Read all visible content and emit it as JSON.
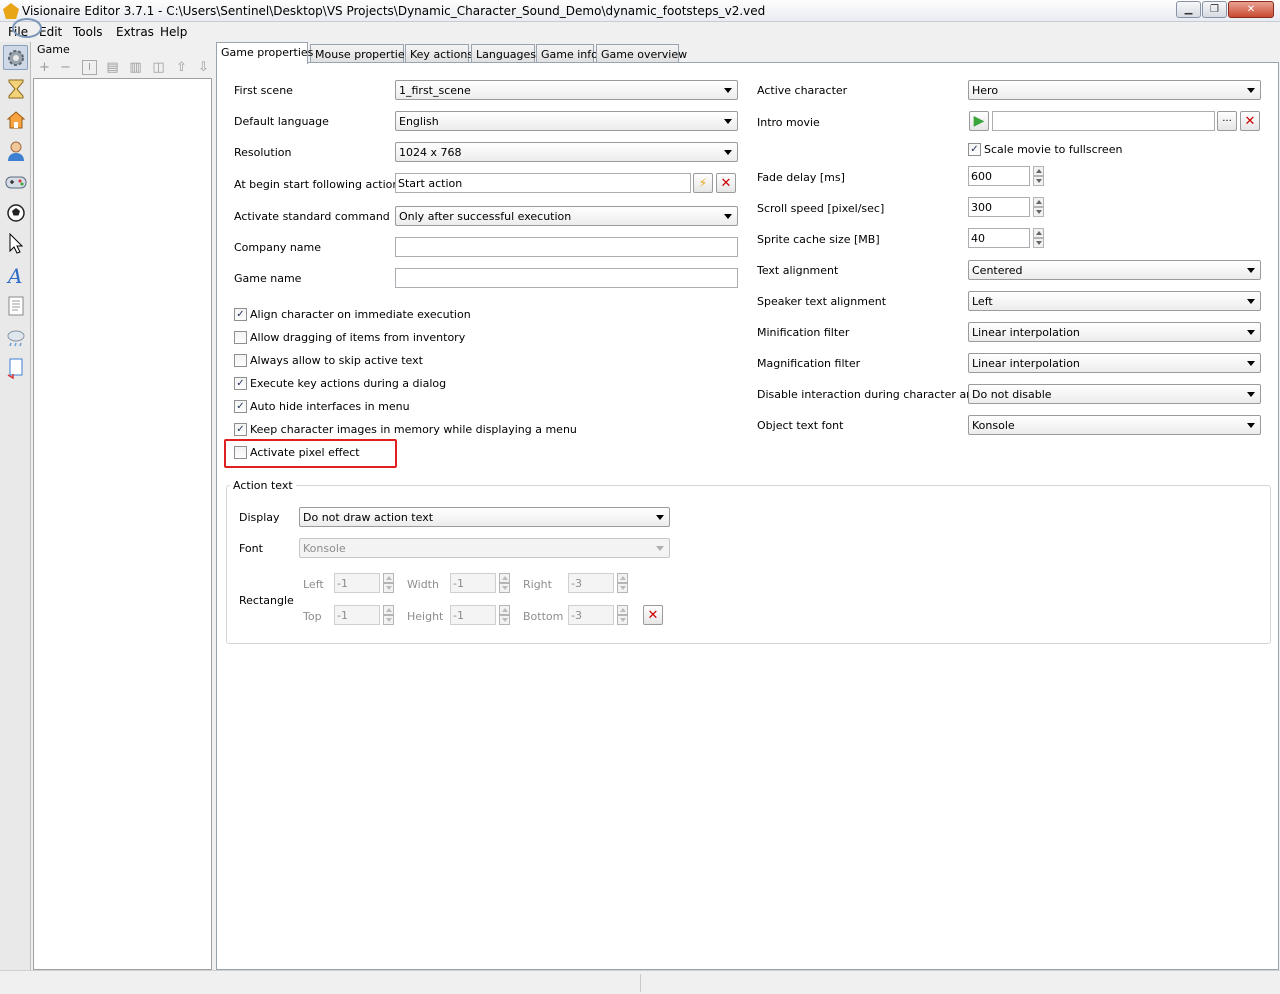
{
  "window": {
    "title": "Visionaire Editor 3.7.1 - C:\\Users\\Sentinel\\Desktop\\VS Projects\\Dynamic_Character_Sound_Demo\\dynamic_footsteps_v2.ved",
    "minimize": "▁",
    "restore": "❐",
    "close": "✕"
  },
  "menu": {
    "file": "File",
    "edit": "Edit",
    "tools": "Tools",
    "extras": "Extras",
    "help": "Help"
  },
  "left_toolbar_icons": [
    "gear-icon",
    "hourglass-icon",
    "house-icon",
    "character-icon",
    "gamepad-icon",
    "ball-icon",
    "cursor-icon",
    "font-icon",
    "document-icon",
    "weather-icon",
    "script-icon"
  ],
  "tree": {
    "header": "Game",
    "toolbar": {
      "add": "+",
      "remove": "−",
      "rename": "I",
      "copy": "▤",
      "paste": "▥",
      "duplicate": "◫",
      "up": "⇧",
      "down": "⇩"
    }
  },
  "tabs": [
    "Game properties",
    "Mouse properties",
    "Key actions",
    "Languages",
    "Game info",
    "Game overview"
  ],
  "left_form": {
    "first_scene": {
      "label": "First scene",
      "value": "1_first_scene"
    },
    "default_language": {
      "label": "Default language",
      "value": "English"
    },
    "resolution": {
      "label": "Resolution",
      "value": "1024 x 768"
    },
    "begin_action": {
      "label": "At begin start following action",
      "value": "Start action"
    },
    "standard_command": {
      "label": "Activate standard command",
      "value": "Only after successful execution"
    },
    "company_name": {
      "label": "Company name",
      "value": ""
    },
    "game_name": {
      "label": "Game name",
      "value": ""
    },
    "checkboxes": [
      {
        "label": "Align character on immediate execution",
        "checked": true
      },
      {
        "label": "Allow dragging of items from inventory",
        "checked": false
      },
      {
        "label": "Always allow to skip active text",
        "checked": false
      },
      {
        "label": "Execute key actions during a dialog",
        "checked": true
      },
      {
        "label": "Auto hide interfaces in menu",
        "checked": true
      },
      {
        "label": "Keep character images in memory while displaying a menu",
        "checked": true
      },
      {
        "label": "Activate pixel effect",
        "checked": false
      }
    ]
  },
  "right_form": {
    "active_character": {
      "label": "Active character",
      "value": "Hero"
    },
    "intro_movie": {
      "label": "Intro movie",
      "value": "",
      "browse": "···"
    },
    "scale_movie": {
      "label": "Scale movie to fullscreen",
      "checked": true
    },
    "fade_delay": {
      "label": "Fade delay [ms]",
      "value": "600"
    },
    "scroll_speed": {
      "label": "Scroll speed [pixel/sec]",
      "value": "300"
    },
    "sprite_cache": {
      "label": "Sprite cache size [MB]",
      "value": "40"
    },
    "text_alignment": {
      "label": "Text alignment",
      "value": "Centered"
    },
    "speaker_text_alignment": {
      "label": "Speaker text alignment",
      "value": "Left"
    },
    "minification_filter": {
      "label": "Minification filter",
      "value": "Linear interpolation"
    },
    "magnification_filter": {
      "label": "Magnification filter",
      "value": "Linear interpolation"
    },
    "disable_interaction": {
      "label": "Disable interaction during character anim.",
      "value": "Do not disable"
    },
    "object_text_font": {
      "label": "Object text font",
      "value": "Konsole"
    }
  },
  "action_text": {
    "title": "Action text",
    "display": {
      "label": "Display",
      "value": "Do not draw action text"
    },
    "font": {
      "label": "Font",
      "value": "Konsole"
    },
    "rectangle": {
      "label": "Rectangle",
      "left": {
        "label": "Left",
        "value": "-1"
      },
      "width": {
        "label": "Width",
        "value": "-1"
      },
      "right": {
        "label": "Right",
        "value": "-3"
      },
      "top": {
        "label": "Top",
        "value": "-1"
      },
      "height": {
        "label": "Height",
        "value": "-1"
      },
      "bottom": {
        "label": "Bottom",
        "value": "-3"
      }
    }
  },
  "icons": {
    "check": "✓",
    "delete": "✕",
    "lightning": "⚡",
    "play": "▶"
  },
  "colors": {
    "highlight": "#e02020",
    "delete_red": "#cc0000",
    "play_green": "#3aa53a"
  }
}
